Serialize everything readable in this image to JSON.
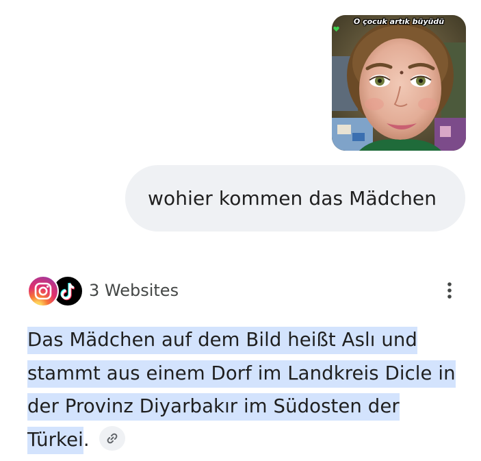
{
  "user_message": {
    "image_caption": "O çocuk artık büyüdü",
    "text": "wohier kommen das Mädchen"
  },
  "sources": {
    "label": "3 Websites",
    "icons": [
      "instagram-icon",
      "tiktok-icon"
    ]
  },
  "answer": {
    "part1": " Das Mädchen auf dem Bild heißt ",
    "name": "Aslı",
    "part2": " und stammt aus einem Dorf im Landkreis ",
    "district": "Dicle",
    "part3": " in der Provinz ",
    "province": "Diyarbakır",
    "part4": " im Südosten der ",
    "country": "Türkei",
    "end": "."
  },
  "colors": {
    "highlight": "#d3e3fd",
    "bubble": "#eff1f4",
    "text": "#1f1f1f",
    "muted": "#444746"
  }
}
